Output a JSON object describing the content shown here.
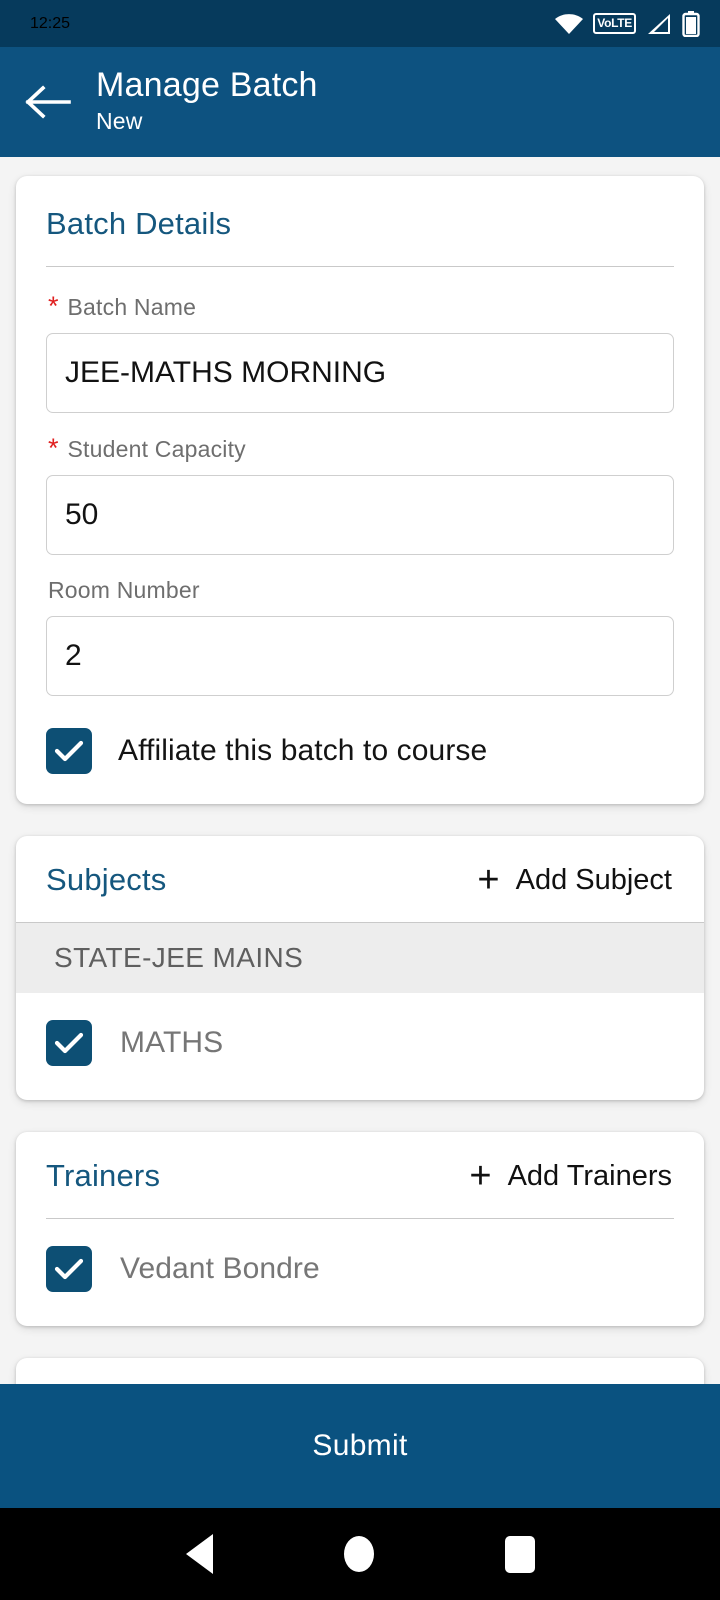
{
  "status_bar": {
    "time": "12:25",
    "icons": [
      {
        "name": "wifi-icon"
      },
      {
        "name": "volte-icon",
        "label": "VoLTE"
      },
      {
        "name": "signal-icon"
      },
      {
        "name": "battery-icon"
      }
    ]
  },
  "app_bar": {
    "back_icon": "back-arrow-icon",
    "title": "Manage Batch",
    "subtitle": "New"
  },
  "batch_details": {
    "title": "Batch Details",
    "fields": [
      {
        "label": "Batch Name",
        "required": true,
        "value": "JEE-MATHS MORNING",
        "placeholder": "Batch Name"
      },
      {
        "label": "Student Capacity",
        "required": true,
        "value": "50",
        "placeholder": "Student Capacity"
      },
      {
        "label": "Room Number",
        "required": false,
        "value": "2",
        "placeholder": "Room Number"
      }
    ],
    "affiliate_checkbox": {
      "label": "Affiliate this batch to course",
      "checked": true
    }
  },
  "subjects": {
    "title": "Subjects",
    "add_label": "Add Subject",
    "add_icon": "plus-icon",
    "groups": [
      {
        "name": "STATE-JEE MAINS",
        "items": [
          {
            "label": "MATHS",
            "checked": true
          }
        ]
      }
    ]
  },
  "trainers": {
    "title": "Trainers",
    "add_label": "Add Trainers",
    "add_icon": "plus-icon",
    "items": [
      {
        "label": "Vedant Bondre",
        "checked": true
      }
    ]
  },
  "submit": {
    "label": "Submit"
  },
  "nav_bar": {
    "back": "nav-back-icon",
    "home": "nav-home-icon",
    "recents": "nav-recents-icon"
  },
  "colors": {
    "status_bar": "#063a5c",
    "app_bar": "#0d5280",
    "accent": "#15577e",
    "checkbox": "#0d4f74",
    "submit": "#0a5280",
    "required": "#e02020",
    "page_bg": "#f4f4f4"
  }
}
